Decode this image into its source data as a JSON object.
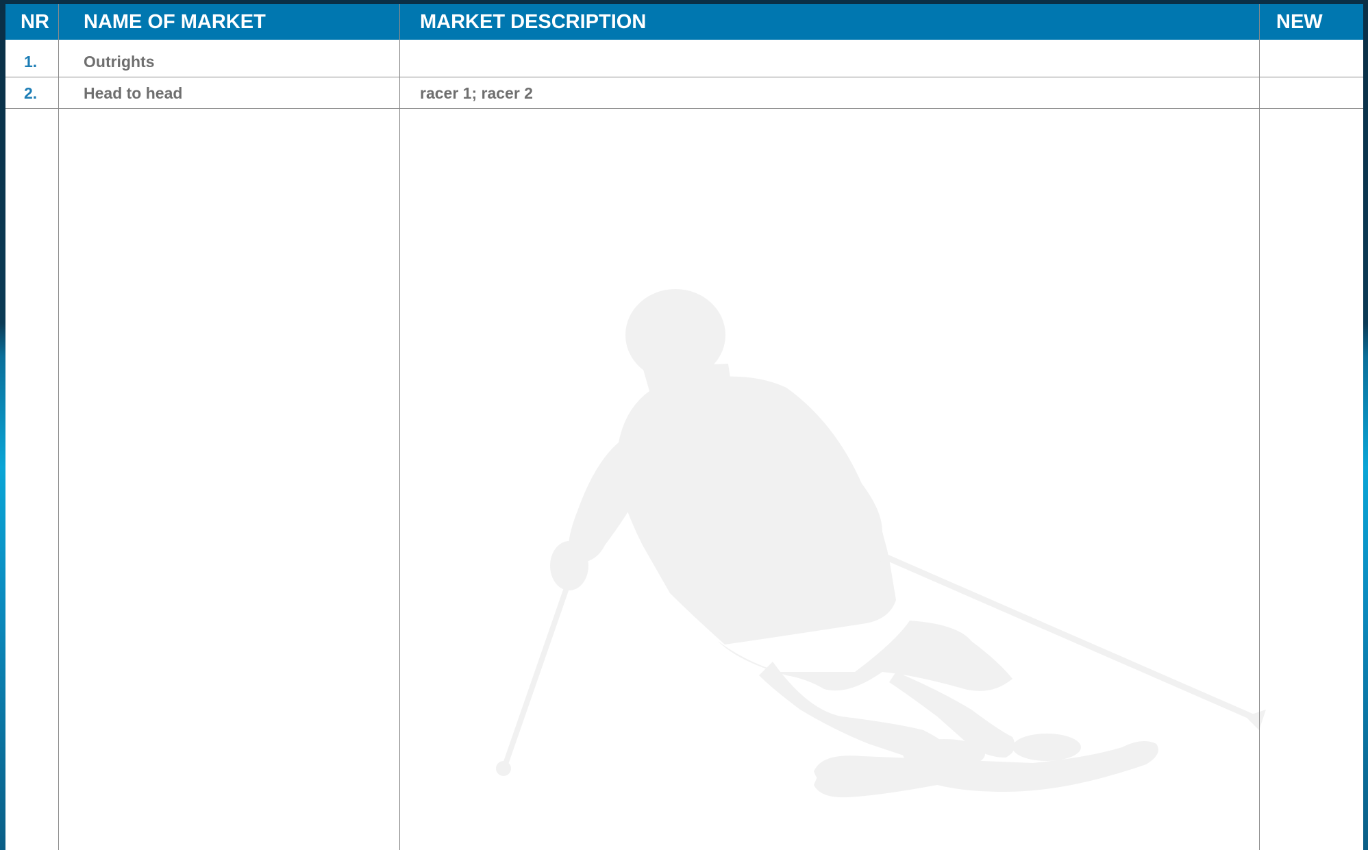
{
  "table": {
    "headers": {
      "nr": "NR",
      "name": "NAME OF MARKET",
      "description": "MARKET DESCRIPTION",
      "new": "NEW"
    },
    "rows": [
      {
        "nr": "1.",
        "name": "Outrights",
        "description": "",
        "new": ""
      },
      {
        "nr": "2.",
        "name": "Head to head",
        "description": "racer 1; racer 2",
        "new": ""
      }
    ]
  },
  "colors": {
    "header_bg": "#0077b0",
    "header_text": "#ffffff",
    "row_number": "#1c7db5",
    "row_text": "#6f6f6f",
    "watermark": "#f1f1f1"
  },
  "watermark": {
    "icon": "skier-silhouette-icon"
  }
}
